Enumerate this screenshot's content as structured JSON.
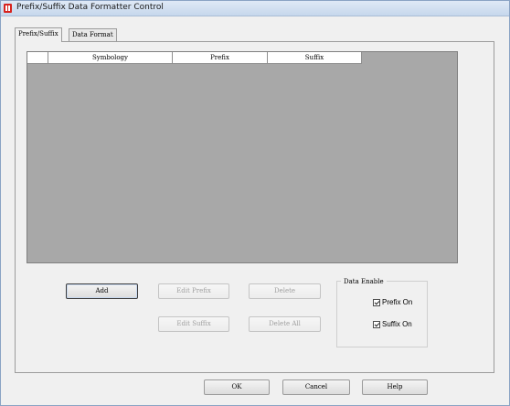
{
  "window": {
    "title": "Prefix/Suffix Data Formatter Control"
  },
  "tabs": [
    {
      "label": "Prefix/Suffix",
      "active": true
    },
    {
      "label": "Data Format",
      "active": false
    }
  ],
  "table": {
    "columns": [
      "",
      "Symbology",
      "Prefix",
      "Suffix"
    ],
    "rows": []
  },
  "buttons": {
    "add": "Add",
    "edit_prefix": "Edit Prefix",
    "delete": "Delete",
    "edit_suffix": "Edit Suffix",
    "delete_all": "Delete All"
  },
  "data_enable": {
    "title": "Data Enable",
    "prefix_on": {
      "label": "Prefix On",
      "checked": true
    },
    "suffix_on": {
      "label": "Suffix On",
      "checked": true
    }
  },
  "footer": {
    "ok": "OK",
    "cancel": "Cancel",
    "help": "Help"
  },
  "colors": {
    "grid_background": "#a8a8a8",
    "titlebar": "#dfe9f6",
    "app_icon": "#d7231e"
  }
}
